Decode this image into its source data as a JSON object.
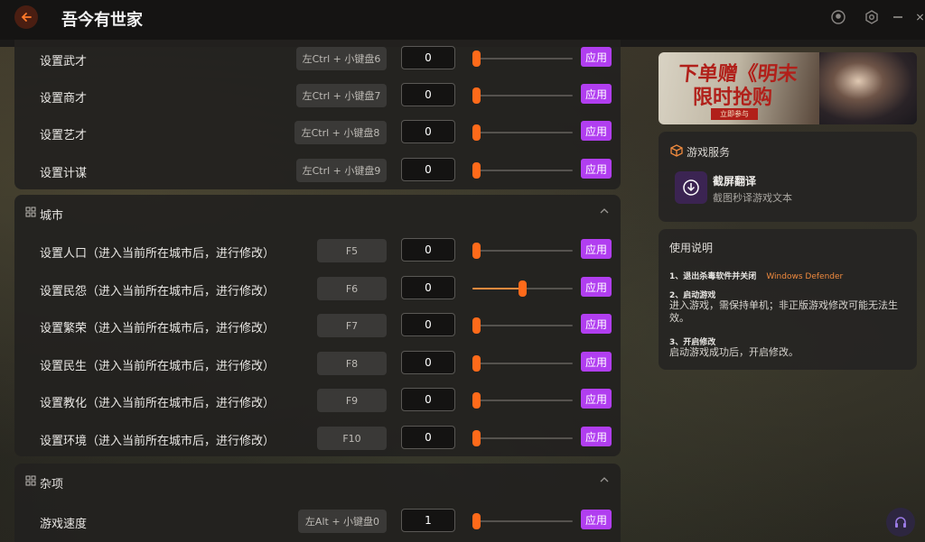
{
  "app": {
    "title": "吾今有世家"
  },
  "panel_top": {
    "rows": [
      {
        "label": "设置武才",
        "hotkey": "左Ctrl + 小键盘6",
        "value": "0",
        "apply": "应用",
        "level": 0
      },
      {
        "label": "设置商才",
        "hotkey": "左Ctrl + 小键盘7",
        "value": "0",
        "apply": "应用",
        "level": 0
      },
      {
        "label": "设置艺才",
        "hotkey": "左Ctrl + 小键盘8",
        "value": "0",
        "apply": "应用",
        "level": 0
      },
      {
        "label": "设置计谋",
        "hotkey": "左Ctrl + 小键盘9",
        "value": "0",
        "apply": "应用",
        "level": 0
      }
    ]
  },
  "section_city": {
    "title": "城市",
    "rows": [
      {
        "label": "设置人口（进入当前所在城市后，进行修改）",
        "hotkey": "F5",
        "value": "0",
        "apply": "应用",
        "level": 0
      },
      {
        "label": "设置民怨（进入当前所在城市后，进行修改）",
        "hotkey": "F6",
        "value": "0",
        "apply": "应用",
        "level": 0.5
      },
      {
        "label": "设置繁荣（进入当前所在城市后，进行修改）",
        "hotkey": "F7",
        "value": "0",
        "apply": "应用",
        "level": 0
      },
      {
        "label": "设置民生（进入当前所在城市后，进行修改）",
        "hotkey": "F8",
        "value": "0",
        "apply": "应用",
        "level": 0
      },
      {
        "label": "设置教化（进入当前所在城市后，进行修改）",
        "hotkey": "F9",
        "value": "0",
        "apply": "应用",
        "level": 0
      },
      {
        "label": "设置环境（进入当前所在城市后，进行修改）",
        "hotkey": "F10",
        "value": "0",
        "apply": "应用",
        "level": 0
      }
    ]
  },
  "section_misc": {
    "title": "杂项",
    "rows": [
      {
        "label": "游戏速度",
        "hotkey": "左Alt + 小键盘0",
        "value": "1",
        "apply": "应用",
        "level": 0
      }
    ]
  },
  "banner": {
    "line1": "下单赠《明末",
    "line2": "限时抢购",
    "button": "立即参与"
  },
  "game_service": {
    "title": "游戏服务",
    "item_title": "截屏翻译",
    "item_desc": "截图秒译游戏文本"
  },
  "help": {
    "title": "使用说明",
    "step1_title": "1、退出杀毒软件并关闭",
    "step1_highlight": "Windows Defender",
    "step2_title": "2、启动游戏",
    "step2_body": "进入游戏，需保持单机；非正版游戏修改可能无法生效。",
    "step3_title": "3、开启修改",
    "step3_body": "启动游戏成功后，开启修改。"
  },
  "colors": {
    "accent": "#f08a3e",
    "apply": "#b13ef0",
    "thumb": "#ff6a1a"
  },
  "icons": {
    "back": "back-arrow-icon",
    "titlebar": [
      "user-icon",
      "settings-icon",
      "minimize-icon",
      "close-icon"
    ],
    "section": "grid-icon",
    "collapse": "chevron-up-icon",
    "service": "cube-icon",
    "translate": "download-circle-icon",
    "support": "headset-icon"
  }
}
